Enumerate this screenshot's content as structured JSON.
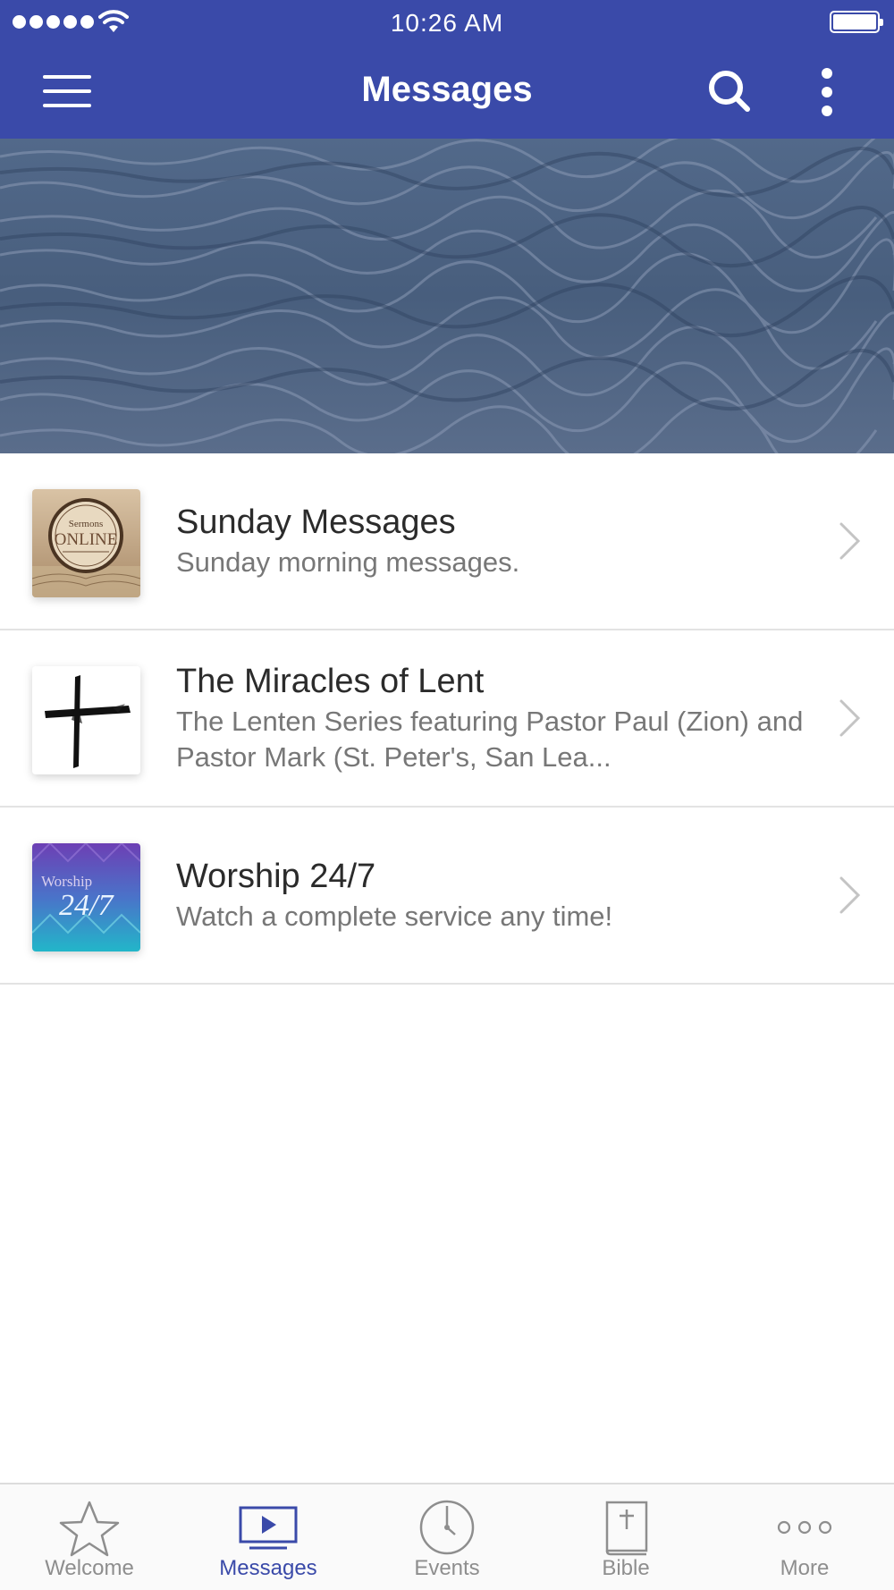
{
  "status_bar": {
    "time": "10:26 AM"
  },
  "nav": {
    "title": "Messages",
    "menu_icon": "hamburger-menu-icon",
    "search_icon": "search-icon",
    "more_icon": "vertical-ellipsis-icon"
  },
  "banner": {
    "image": "ocean-water-photo"
  },
  "list": [
    {
      "title": "Sunday Messages",
      "subtitle": "Sunday morning messages.",
      "thumbnail": "sermons-online-bible-thumbnail",
      "thumb_text_1": "Sermons",
      "thumb_text_2": "ONLINE"
    },
    {
      "title": "The Miracles of Lent",
      "subtitle": "The Lenten Series featuring Pastor Paul (Zion) and Pastor Mark (St. Peter's, San Lea...",
      "thumbnail": "black-cross-thumbnail"
    },
    {
      "title": "Worship 24/7",
      "subtitle": "Watch a complete service any time!",
      "thumbnail": "worship-24-7-thumbnail",
      "thumb_text_1": "Worship",
      "thumb_text_2": "24/7"
    }
  ],
  "tabbar": {
    "tabs": [
      {
        "label": "Welcome",
        "icon": "star-icon",
        "active": false
      },
      {
        "label": "Messages",
        "icon": "play-video-icon",
        "active": true
      },
      {
        "label": "Events",
        "icon": "clock-icon",
        "active": false
      },
      {
        "label": "Bible",
        "icon": "bible-icon",
        "active": false
      },
      {
        "label": "More",
        "icon": "more-dots-icon",
        "active": false
      }
    ]
  },
  "colors": {
    "primary": "#3a4aa9",
    "inactive_tab": "#8e8e8e",
    "divider": "#e3e3e3"
  }
}
